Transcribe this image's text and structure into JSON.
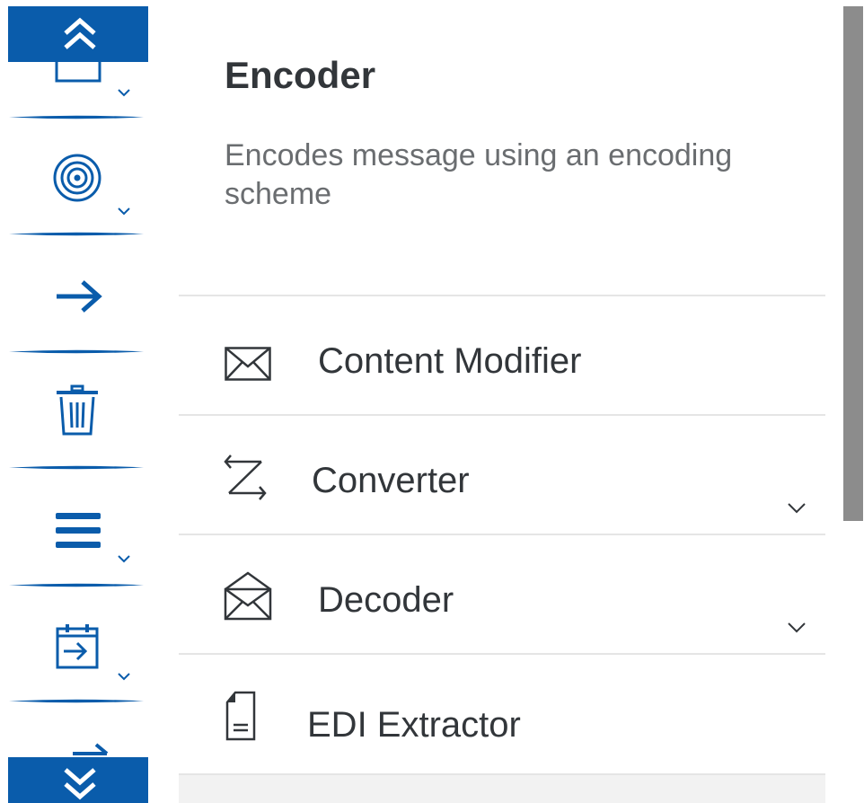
{
  "palette": {
    "scroll_up_label": "Scroll up",
    "scroll_down_label": "Scroll down",
    "accent_color": "#0a5cab",
    "items": [
      {
        "icon": "message-box-icon",
        "has_dropdown": true
      },
      {
        "icon": "target-icon",
        "has_dropdown": true
      },
      {
        "icon": "arrow-right-icon",
        "has_dropdown": false
      },
      {
        "icon": "trash-icon",
        "has_dropdown": false
      },
      {
        "icon": "list-icon",
        "has_dropdown": true
      },
      {
        "icon": "calendar-arrow-icon",
        "has_dropdown": true
      }
    ]
  },
  "details": {
    "title": "Encoder",
    "description": "Encodes message using an encoding scheme"
  },
  "steps": [
    {
      "label": "Content Modifier",
      "icon": "envelope-icon",
      "has_dropdown": false
    },
    {
      "label": "Converter",
      "icon": "converter-icon",
      "has_dropdown": true
    },
    {
      "label": "Decoder",
      "icon": "open-envelope-icon",
      "has_dropdown": true
    },
    {
      "label": "EDI Extractor",
      "icon": "document-icon",
      "has_dropdown": false
    }
  ]
}
